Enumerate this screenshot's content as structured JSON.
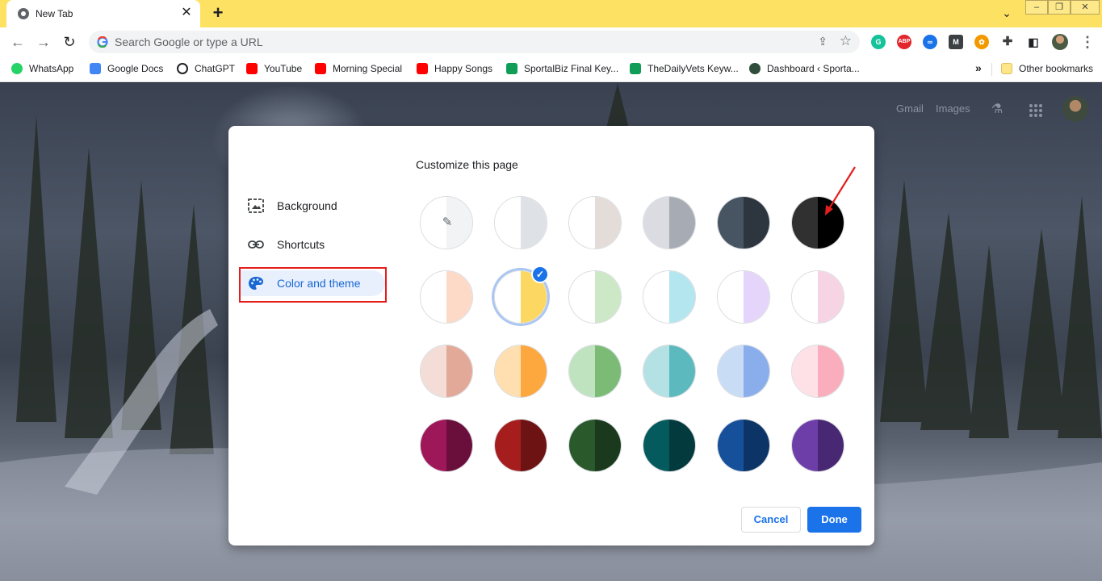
{
  "tab": {
    "title": "New Tab",
    "close_glyph": "✕"
  },
  "omnibox": {
    "placeholder": "Search Google or type a URL"
  },
  "bookmarks": [
    {
      "label": "WhatsApp",
      "icon": "whatsapp-icon",
      "color": "#25d366"
    },
    {
      "label": "Google Docs",
      "icon": "google-docs-icon",
      "color": "#4285f4"
    },
    {
      "label": "ChatGPT",
      "icon": "chatgpt-icon",
      "color": "#202124"
    },
    {
      "label": "YouTube",
      "icon": "youtube-icon",
      "color": "#ff0000"
    },
    {
      "label": "Morning Special",
      "icon": "youtube-icon",
      "color": "#ff0000"
    },
    {
      "label": "Happy Songs",
      "icon": "youtube-icon",
      "color": "#ff0000"
    },
    {
      "label": "SportalBiz Final Key...",
      "icon": "google-sheets-icon",
      "color": "#0f9d58"
    },
    {
      "label": "TheDailyVets Keyw...",
      "icon": "google-sheets-icon",
      "color": "#0f9d58"
    },
    {
      "label": "Dashboard ‹ Sporta...",
      "icon": "site-icon",
      "color": "#2e4d3a"
    }
  ],
  "other_bookmarks": "Other bookmarks",
  "ntp": {
    "gmail": "Gmail",
    "images": "Images"
  },
  "dialog": {
    "title": "Customize this page",
    "sidebar": [
      {
        "label": "Background",
        "icon": "image-icon"
      },
      {
        "label": "Shortcuts",
        "icon": "link-icon"
      },
      {
        "label": "Color and theme",
        "icon": "palette-icon",
        "active": true
      }
    ],
    "cancel_label": "Cancel",
    "done_label": "Done",
    "selected_theme": "yellow",
    "themes": [
      {
        "name": "custom-color-picker",
        "left": "#ffffff",
        "right": "#f1f3f4"
      },
      {
        "name": "default-light",
        "left": "#ffffff",
        "right": "#dee1e6"
      },
      {
        "name": "warm-grey",
        "left": "#ffffff",
        "right": "#e3dcd8"
      },
      {
        "name": "cool-grey",
        "left": "#dadce2",
        "right": "#a7abb3"
      },
      {
        "name": "blue-grey",
        "left": "#475461",
        "right": "#2d363f"
      },
      {
        "name": "black",
        "left": "#303030",
        "right": "#000000"
      },
      {
        "name": "beige-peach",
        "left": "#ffffff",
        "right": "#fddac7"
      },
      {
        "name": "yellow",
        "left": "#ffffff",
        "right": "#fcd761"
      },
      {
        "name": "light-green",
        "left": "#ffffff",
        "right": "#cce8c7"
      },
      {
        "name": "light-cyan",
        "left": "#ffffff",
        "right": "#b4e6f0"
      },
      {
        "name": "light-purple",
        "left": "#ffffff",
        "right": "#e6d5fb"
      },
      {
        "name": "light-pink",
        "left": "#ffffff",
        "right": "#f6d4e4"
      },
      {
        "name": "salmon",
        "left": "#f3ddd6",
        "right": "#e2a998"
      },
      {
        "name": "orange",
        "left": "#ffdeb0",
        "right": "#fda83e"
      },
      {
        "name": "green",
        "left": "#bfe2bf",
        "right": "#7bbb76"
      },
      {
        "name": "teal",
        "left": "#b4e1e3",
        "right": "#5cb9bd"
      },
      {
        "name": "blue",
        "left": "#c9dcf6",
        "right": "#8aaeeb"
      },
      {
        "name": "pink",
        "left": "#fde1e7",
        "right": "#faadbc"
      },
      {
        "name": "dark-magenta",
        "left": "#9e1758",
        "right": "#6a0f3b"
      },
      {
        "name": "dark-red",
        "left": "#a51d1d",
        "right": "#6d1313"
      },
      {
        "name": "dark-green",
        "left": "#2a5a2c",
        "right": "#1b3a1d"
      },
      {
        "name": "dark-teal",
        "left": "#055a5e",
        "right": "#033a3d"
      },
      {
        "name": "dark-blue",
        "left": "#17509a",
        "right": "#0d3467"
      },
      {
        "name": "dark-purple",
        "left": "#6e3ea8",
        "right": "#482872"
      }
    ]
  }
}
